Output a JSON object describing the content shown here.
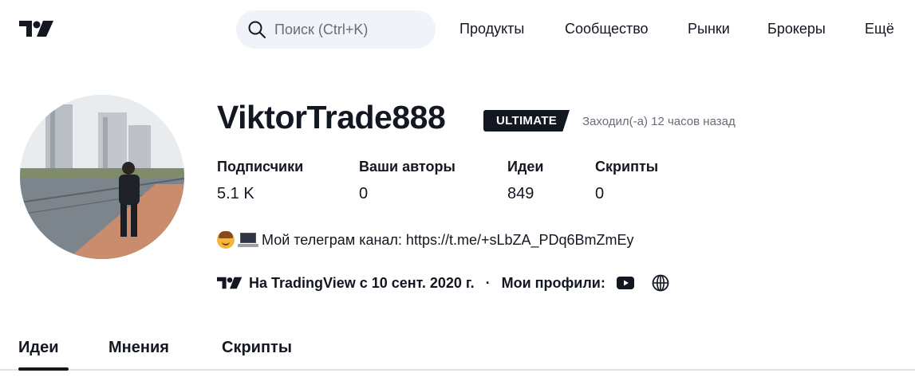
{
  "header": {
    "logo_icon": "tradingview-logo-icon",
    "search": {
      "label": "Поиск (Ctrl+K)",
      "icon": "search-icon"
    },
    "nav": [
      "Продукты",
      "Сообщество",
      "Рынки",
      "Брокеры",
      "Ещё"
    ]
  },
  "profile": {
    "username": "ViktorTrade888",
    "badge": "ULTIMATE",
    "last_seen": "Заходил(-а) 12 часов назад",
    "stats": [
      {
        "label": "Подписчики",
        "value": "5.1 K"
      },
      {
        "label": "Ваши авторы",
        "value": "0"
      },
      {
        "label": "Идеи",
        "value": "849"
      },
      {
        "label": "Скрипты",
        "value": "0"
      }
    ],
    "bio": "Мой телеграм канал: https://t.me/+sLbZA_PDq6BmZmEy",
    "since": "На TradingView с 10 сент. 2020 г.",
    "separator": "·",
    "profiles_label": "Мои профили:",
    "profile_icons": [
      "youtube-icon",
      "globe-icon"
    ]
  },
  "tabs": [
    {
      "label": "Идеи",
      "active": true
    },
    {
      "label": "Мнения",
      "active": false
    },
    {
      "label": "Скрипты",
      "active": false
    }
  ],
  "colors": {
    "text": "#131722",
    "muted": "#6a6d78",
    "search_bg": "#f0f3fa",
    "badge_bg": "#131722"
  }
}
